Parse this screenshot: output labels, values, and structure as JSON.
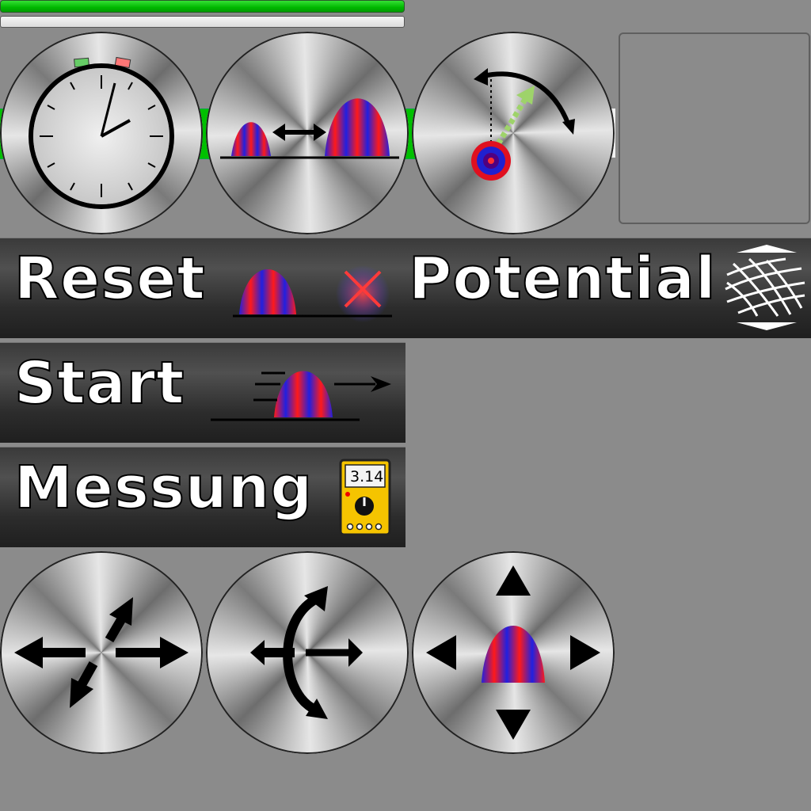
{
  "buttons": {
    "reset": "Reset",
    "potential": "Potential",
    "start": "Start",
    "measure": "Messung"
  },
  "meter": {
    "reading": "3.14"
  },
  "colors": {
    "wave_red": "#ff1a1a",
    "wave_blue": "#2020e0",
    "progress_green": "#00c000",
    "background": "#8b8b8b"
  }
}
